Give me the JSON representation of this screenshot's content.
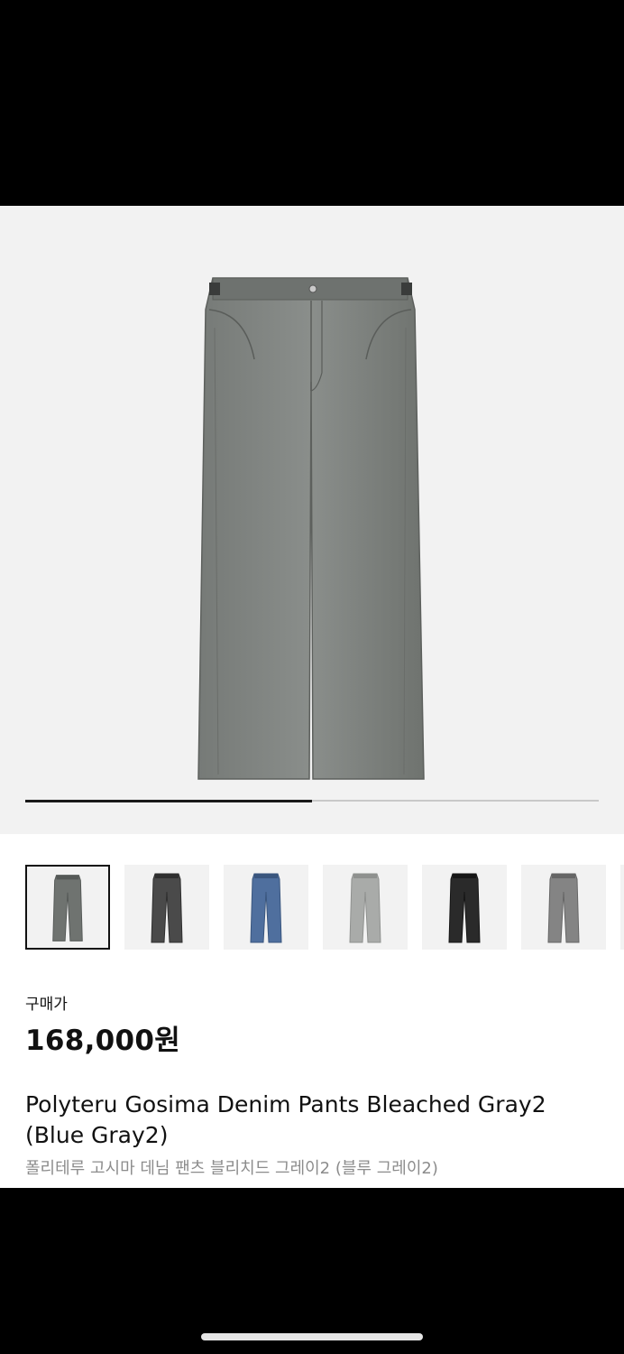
{
  "gallery": {
    "image_icon": "pants-image",
    "progress": 0.5
  },
  "thumbnails": [
    {
      "name": "Bleached Gray2 thumbnail",
      "selected": true,
      "color": "#6f7370",
      "dark": "#555957"
    },
    {
      "name": "Gray thumbnail",
      "selected": false,
      "color": "#4a4a4a",
      "dark": "#2f2f2f"
    },
    {
      "name": "Blue thumbnail",
      "selected": false,
      "color": "#4f6f9e",
      "dark": "#3a567e"
    },
    {
      "name": "Light Gray thumbnail",
      "selected": false,
      "color": "#a9aba9",
      "dark": "#8f918f"
    },
    {
      "name": "Black thumbnail",
      "selected": false,
      "color": "#2a2a2a",
      "dark": "#161616"
    },
    {
      "name": "Gray2 thumbnail",
      "selected": false,
      "color": "#848484",
      "dark": "#666666"
    }
  ],
  "price": {
    "label": "구매가",
    "value": "168,000원"
  },
  "product": {
    "name_en": "Polyteru Gosima Denim Pants Bleached Gray2 (Blue Gray2)",
    "name_kr": "폴리테루 고시마 데님 팬츠 블리치드 그레이2 (블루 그레이2)"
  },
  "colors": {
    "main_pants": "#7a7d7a",
    "main_pants_dark": "#626562"
  }
}
